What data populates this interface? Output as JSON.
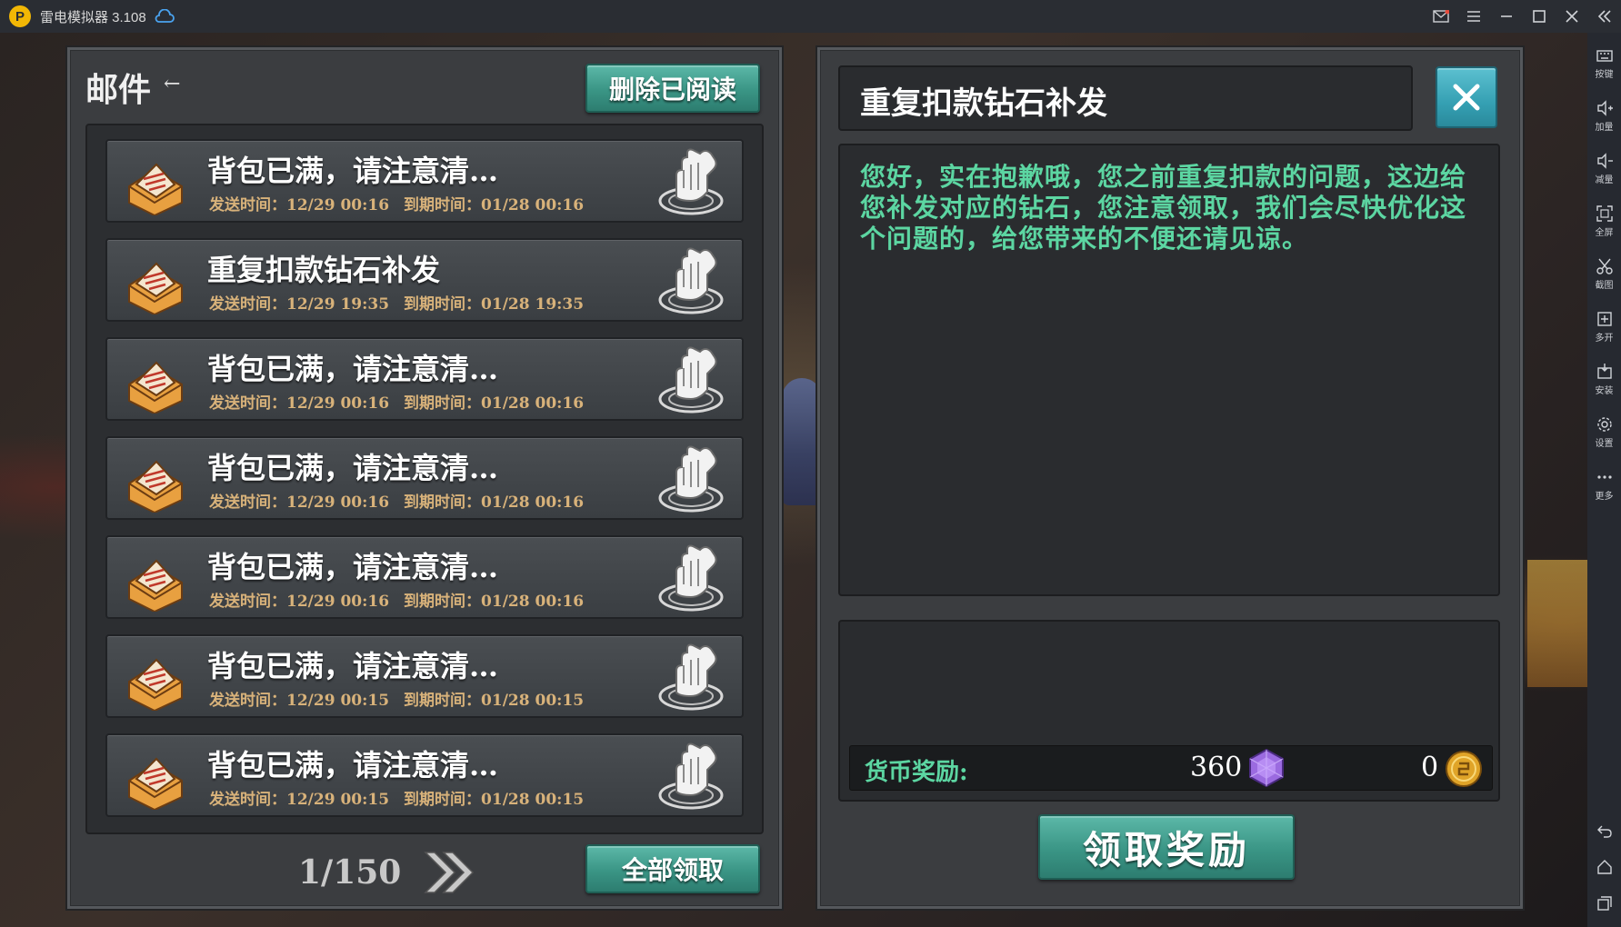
{
  "window": {
    "title": "雷电模拟器 3.108",
    "logo_glyph": "P",
    "icons": [
      "cloud-icon",
      "mail-icon",
      "menu-icon",
      "minimize-icon",
      "maximize-icon",
      "close-icon",
      "collapse-icon"
    ]
  },
  "sidebar": {
    "items": [
      {
        "label": "按键",
        "icon": "keyboard-icon"
      },
      {
        "label": "加量",
        "icon": "volume-up-icon"
      },
      {
        "label": "减量",
        "icon": "volume-down-icon"
      },
      {
        "label": "全屏",
        "icon": "fullscreen-icon"
      },
      {
        "label": "截图",
        "icon": "scissors-icon"
      },
      {
        "label": "多开",
        "icon": "multi-instance-icon"
      },
      {
        "label": "安装",
        "icon": "install-apk-icon"
      },
      {
        "label": "设置",
        "icon": "gear-icon"
      },
      {
        "label": "更多",
        "icon": "more-icon"
      }
    ],
    "bottom_icons": [
      "back-icon",
      "home-icon",
      "recent-apps-icon"
    ]
  },
  "mail": {
    "title": "邮件",
    "title_arrow": "←",
    "delete_read_label": "删除已阅读",
    "claim_all_label": "全部领取",
    "page_indicator": "1/150",
    "next_icon": "double-chevron-right-icon",
    "items": [
      {
        "subject": "背包已满，请注意清…",
        "sent": "发送时间：12/29 00:16",
        "expire": "到期时间：01/28 00:16"
      },
      {
        "subject": "重复扣款钻石补发",
        "sent": "发送时间：12/29 19:35",
        "expire": "到期时间：01/28 19:35"
      },
      {
        "subject": "背包已满，请注意清…",
        "sent": "发送时间：12/29 00:16",
        "expire": "到期时间：01/28 00:16"
      },
      {
        "subject": "背包已满，请注意清…",
        "sent": "发送时间：12/29 00:16",
        "expire": "到期时间：01/28 00:16"
      },
      {
        "subject": "背包已满，请注意清…",
        "sent": "发送时间：12/29 00:16",
        "expire": "到期时间：01/28 00:16"
      },
      {
        "subject": "背包已满，请注意清…",
        "sent": "发送时间：12/29 00:15",
        "expire": "到期时间：01/28 00:15"
      },
      {
        "subject": "背包已满，请注意清…",
        "sent": "发送时间：12/29 00:15",
        "expire": "到期时间：01/28 00:15"
      }
    ]
  },
  "detail": {
    "title": "重复扣款钻石补发",
    "body": "您好，实在抱歉哦，您之前重复扣款的问题，这边给您补发对应的钻石，您注意领取，我们会尽快优化这个问题的，给您带来的不便还请见谅。",
    "currency_label": "货币奖励:",
    "diamond_amount": "360",
    "gold_amount": "0",
    "claim_reward_label": "领取奖励"
  },
  "colors": {
    "accent_teal": "#3a9585",
    "body_text_green": "#5cd6a2",
    "time_text": "#d8b27a"
  }
}
